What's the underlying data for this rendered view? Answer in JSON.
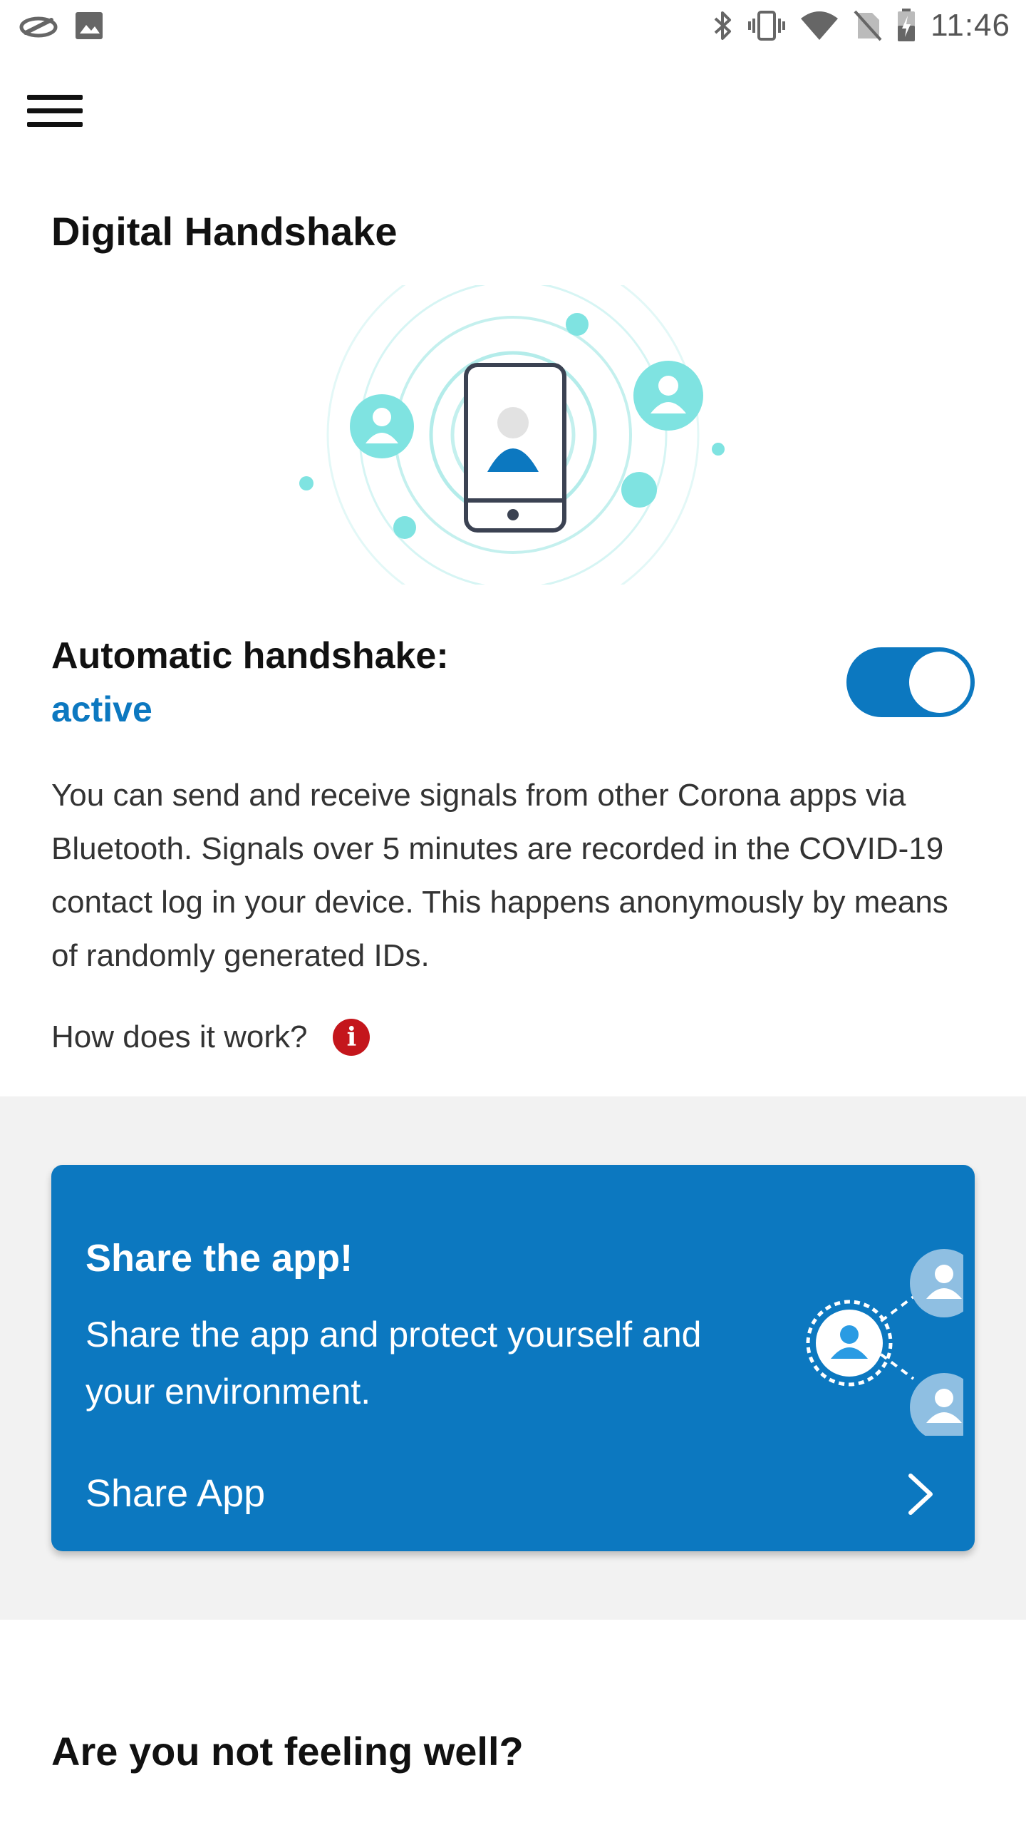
{
  "status_bar": {
    "time": "11:46",
    "left_icons": [
      "app-notification-icon",
      "image-icon"
    ],
    "right_icons": [
      "bluetooth-icon",
      "vibrate-icon",
      "wifi-icon",
      "no-sim-icon",
      "battery-icon"
    ]
  },
  "app_bar": {
    "menu_icon": "hamburger-menu-icon"
  },
  "handshake": {
    "title": "Digital Handshake",
    "auto_label": "Automatic handshake:",
    "status": "active",
    "toggle_on": true,
    "description": "You can send and receive signals from other Corona apps via Bluetooth. Signals over 5 minutes are recorded in the COVID-19 contact log in your device. This happens anonymously by means of randomly generated IDs.",
    "how_link": "How does it work?",
    "info_glyph": "i"
  },
  "share_card": {
    "title": "Share the app!",
    "description": "Share the app and protect yourself and your environment.",
    "link_label": "Share App"
  },
  "feeling": {
    "title": "Are you not feeling well?"
  },
  "colors": {
    "primary": "#0c78c0",
    "teal": "#7fe3e1",
    "info_red": "#c4161c",
    "band_grey": "#f2f2f2"
  }
}
